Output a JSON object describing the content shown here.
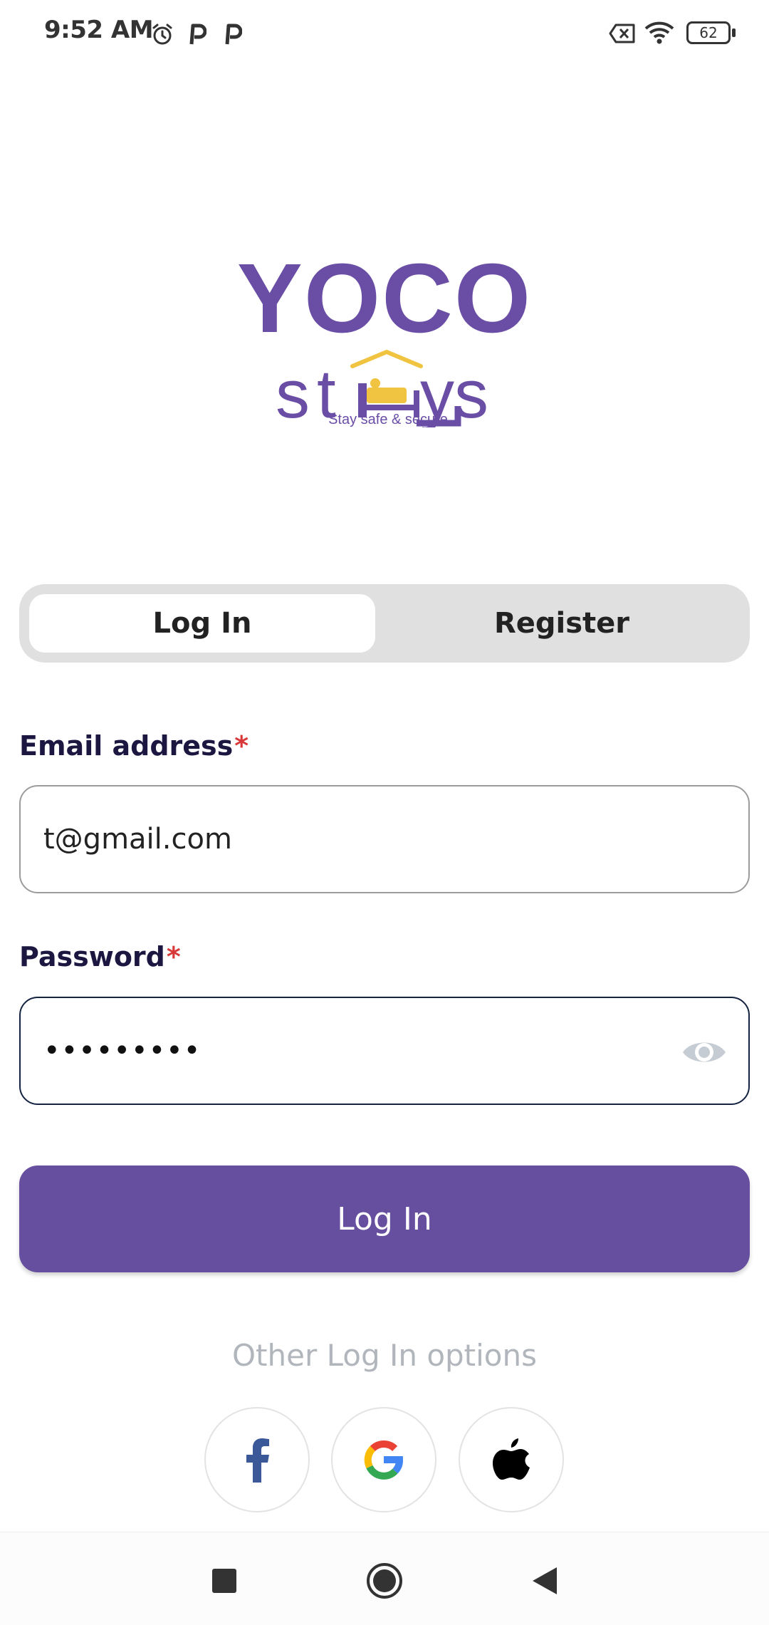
{
  "status_bar": {
    "time": "9:52 AM",
    "icons": [
      "alarm-icon",
      "parking-icon",
      "parking-icon",
      "no-sim-icon",
      "wifi-icon",
      "battery-icon"
    ],
    "battery_level": "62"
  },
  "logo": {
    "brand_top": "YOCO",
    "brand_bottom": "stays",
    "tagline": "Stay safe & secure",
    "colors": {
      "purple": "#6a4ea6",
      "gold": "#f0c341"
    }
  },
  "tabs": [
    {
      "label": "Log In",
      "selected": true
    },
    {
      "label": "Register",
      "selected": false
    }
  ],
  "form": {
    "email": {
      "label": "Email address",
      "required_mark": "*",
      "value": "t@gmail.com"
    },
    "password": {
      "label": "Password",
      "required_mark": "*",
      "value_masked": "•••••••••",
      "toggle_icon": "eye-icon"
    },
    "submit_label": "Log In"
  },
  "other_options": {
    "label": "Other Log In options",
    "providers": [
      "facebook-icon",
      "google-icon",
      "apple-icon"
    ]
  },
  "nav_bar": {
    "buttons": [
      "recents-square-icon",
      "home-circle-icon",
      "back-triangle-icon"
    ]
  },
  "colors": {
    "accent": "#674f9f",
    "segment_bg": "#e0e0e0",
    "required": "#d93838",
    "muted_text": "#b1b6bc"
  }
}
